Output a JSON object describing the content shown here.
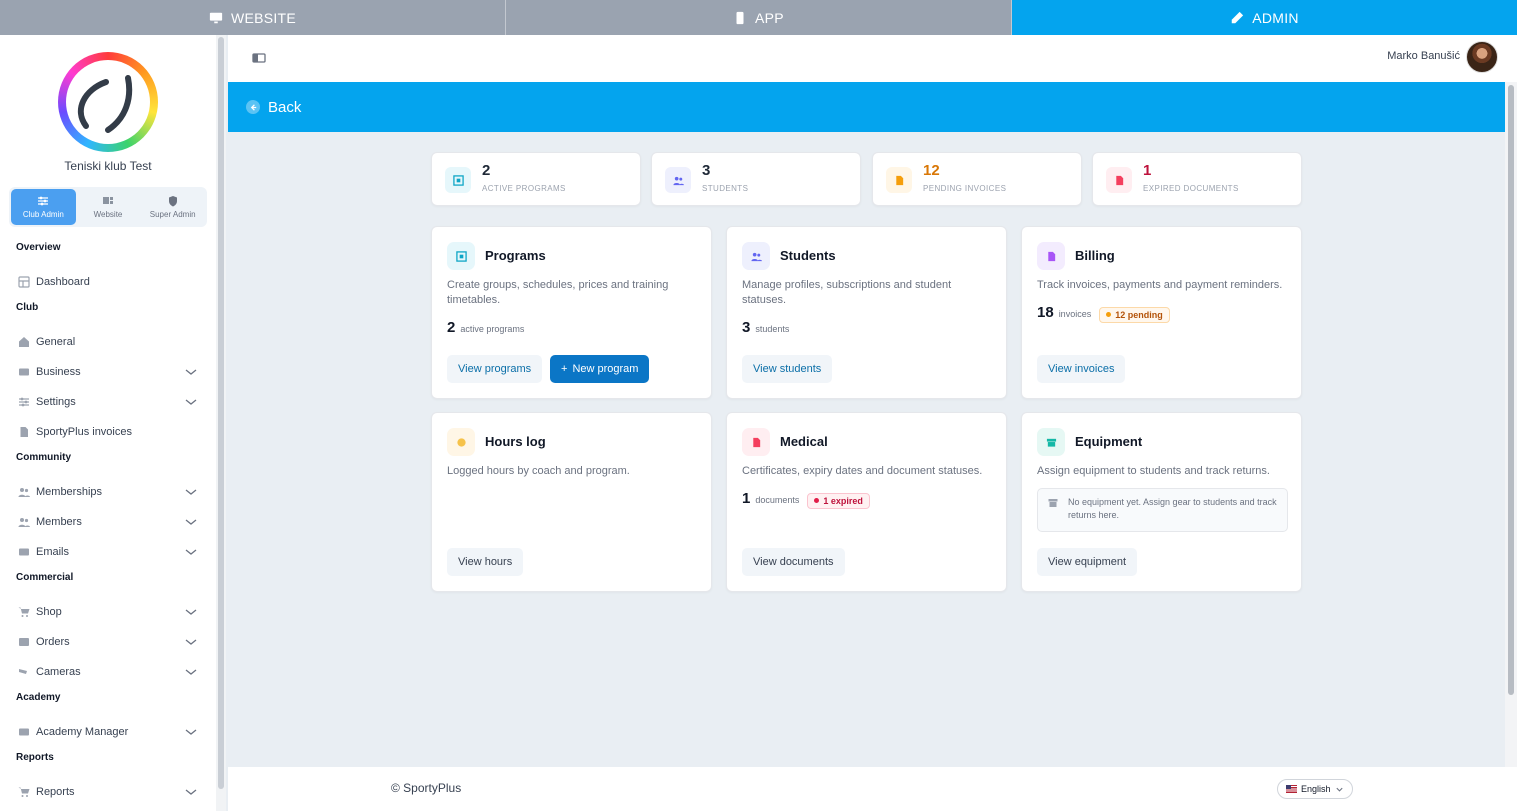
{
  "modes": [
    {
      "label": "WEBSITE",
      "icon": "monitor-icon",
      "active": false
    },
    {
      "label": "APP",
      "icon": "mobile-icon",
      "active": false
    },
    {
      "label": "ADMIN",
      "icon": "pencil-icon",
      "active": true
    }
  ],
  "sidebar": {
    "club_name": "Teniski klub Test",
    "roles": [
      {
        "label": "Club Admin",
        "icon": "sliders-icon",
        "active": true
      },
      {
        "label": "Website",
        "icon": "layout-icon",
        "active": false
      },
      {
        "label": "Super Admin",
        "icon": "shield-icon",
        "active": false
      }
    ],
    "sections": [
      {
        "title": "Overview",
        "items": [
          {
            "label": "Dashboard",
            "icon": "dashboard-icon",
            "expandable": false
          }
        ]
      },
      {
        "title": "Club",
        "items": [
          {
            "label": "General",
            "icon": "home-icon",
            "expandable": false
          },
          {
            "label": "Business",
            "icon": "card-icon",
            "expandable": true
          },
          {
            "label": "Settings",
            "icon": "sliders-icon",
            "expandable": true
          },
          {
            "label": "SportyPlus invoices",
            "icon": "document-icon",
            "expandable": false
          }
        ]
      },
      {
        "title": "Community",
        "items": [
          {
            "label": "Memberships",
            "icon": "users-icon",
            "expandable": true
          },
          {
            "label": "Members",
            "icon": "users-icon",
            "expandable": true
          },
          {
            "label": "Emails",
            "icon": "mail-icon",
            "expandable": true
          }
        ]
      },
      {
        "title": "Commercial",
        "items": [
          {
            "label": "Shop",
            "icon": "cart-icon",
            "expandable": true
          },
          {
            "label": "Orders",
            "icon": "box-icon",
            "expandable": true
          },
          {
            "label": "Cameras",
            "icon": "camera-icon",
            "expandable": true
          }
        ]
      },
      {
        "title": "Academy",
        "items": [
          {
            "label": "Academy Manager",
            "icon": "card-icon",
            "expandable": true
          }
        ]
      },
      {
        "title": "Reports",
        "items": [
          {
            "label": "Reports",
            "icon": "cart-icon",
            "expandable": true
          }
        ]
      }
    ]
  },
  "header": {
    "user_name": "Marko Banušić"
  },
  "back_label": "Back",
  "stats": [
    {
      "value": "2",
      "label": "ACTIVE PROGRAMS",
      "color": "#111827",
      "icon": "grid-icon",
      "icon_color": "#0ea5c6",
      "icon_bg": "#e6f7fb"
    },
    {
      "value": "3",
      "label": "STUDENTS",
      "color": "#111827",
      "icon": "users-icon",
      "icon_color": "#6366f1",
      "icon_bg": "#eef0fd"
    },
    {
      "value": "12",
      "label": "PENDING INVOICES",
      "color": "#d97706",
      "icon": "invoice-icon",
      "icon_color": "#f59e0b",
      "icon_bg": "#fff6e6"
    },
    {
      "value": "1",
      "label": "EXPIRED DOCUMENTS",
      "color": "#be123c",
      "icon": "document-icon",
      "icon_color": "#f43f5e",
      "icon_bg": "#ffeef1"
    }
  ],
  "cards": {
    "programs": {
      "title": "Programs",
      "desc": "Create groups, schedules, prices and training timetables.",
      "count": "2",
      "unit": "active programs",
      "btn_view": "View programs",
      "btn_new": "New program"
    },
    "students": {
      "title": "Students",
      "desc": "Manage profiles, subscriptions and student statuses.",
      "count": "3",
      "unit": "students",
      "btn_view": "View students"
    },
    "billing": {
      "title": "Billing",
      "desc": "Track invoices, payments and payment reminders.",
      "count": "18",
      "unit": "invoices",
      "pill": "12 pending",
      "btn_view": "View invoices"
    },
    "hours": {
      "title": "Hours log",
      "desc": "Logged hours by coach and program.",
      "btn_view": "View hours"
    },
    "medical": {
      "title": "Medical",
      "desc": "Certificates, expiry dates and document statuses.",
      "count": "1",
      "unit": "documents",
      "pill": "1 expired",
      "btn_view": "View documents"
    },
    "equipment": {
      "title": "Equipment",
      "desc": "Assign equipment to students and track returns.",
      "empty": "No equipment yet. Assign gear to students and track returns here.",
      "btn_view": "View equipment"
    }
  },
  "footer": {
    "copyright": "© SportyPlus",
    "language": "English"
  }
}
